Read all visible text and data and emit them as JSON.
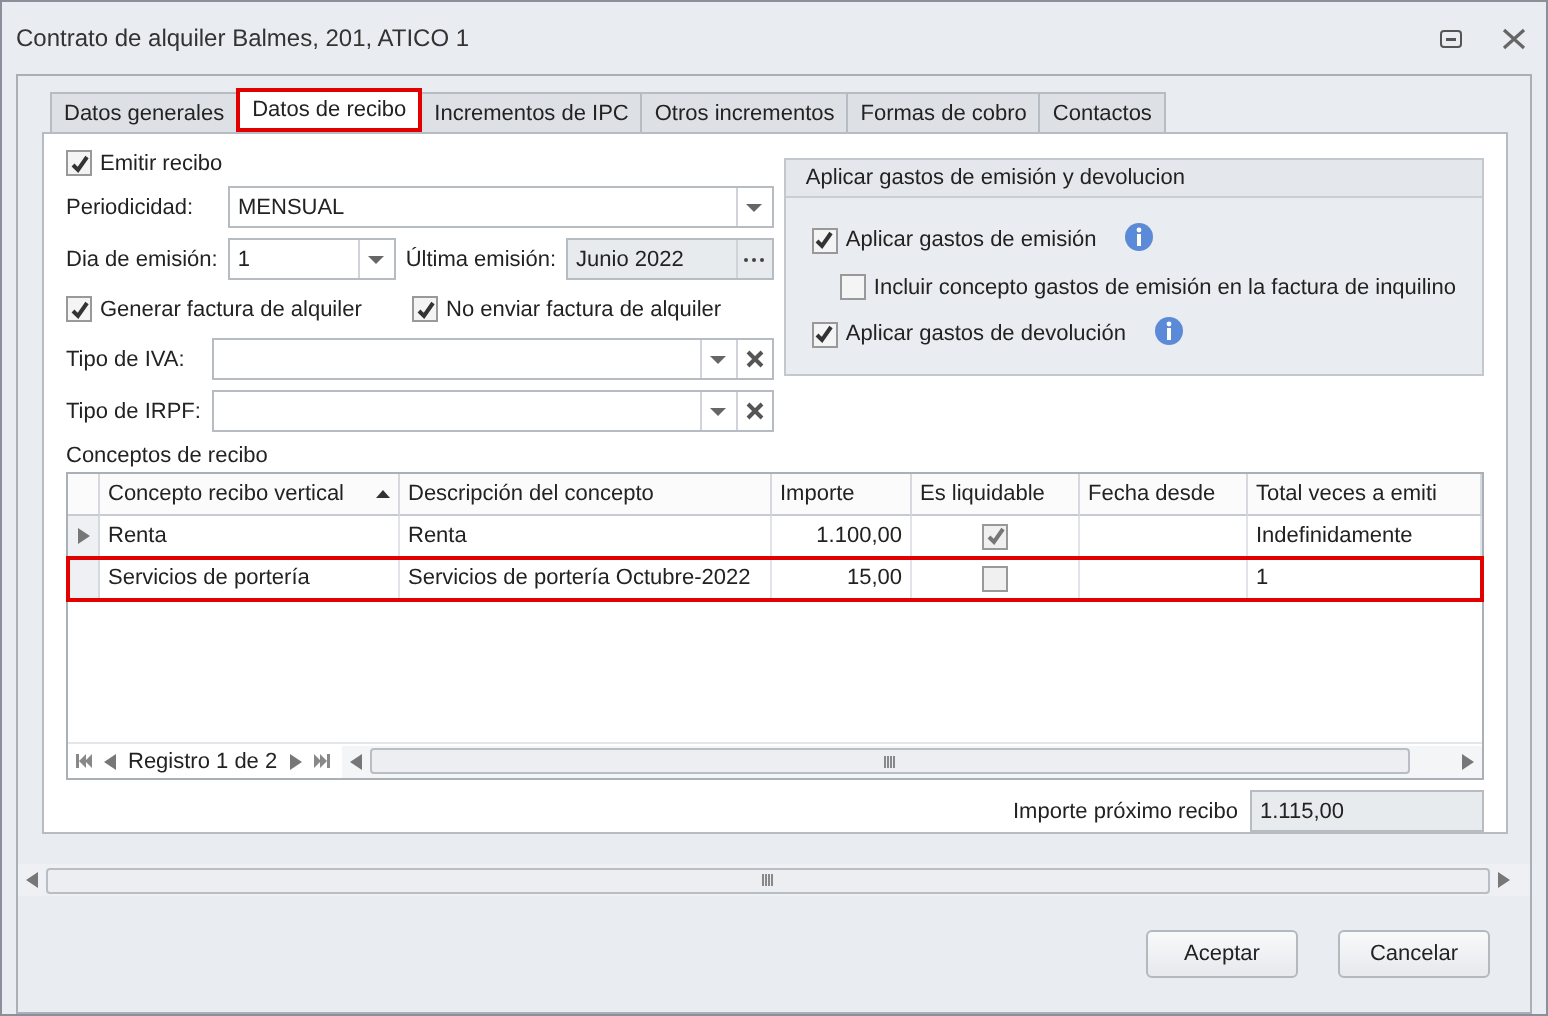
{
  "window": {
    "title": "Contrato de alquiler Balmes, 201, ATICO 1"
  },
  "tabs": [
    {
      "label": "Datos generales",
      "selected": false
    },
    {
      "label": "Datos de recibo",
      "selected": true
    },
    {
      "label": "Incrementos de IPC",
      "selected": false
    },
    {
      "label": "Otros incrementos",
      "selected": false
    },
    {
      "label": "Formas de cobro",
      "selected": false
    },
    {
      "label": "Contactos",
      "selected": false
    }
  ],
  "emit_receipt": {
    "label": "Emitir recibo",
    "checked": true
  },
  "periodicity": {
    "label": "Periodicidad:",
    "value": "MENSUAL"
  },
  "issue_day": {
    "label": "Dia de emisión:",
    "value": "1"
  },
  "last_issue": {
    "label": "Última emisión:",
    "value": "Junio 2022"
  },
  "invoice_options": [
    {
      "label": "Generar factura de alquiler",
      "checked": true
    },
    {
      "label": "No enviar factura de alquiler",
      "checked": true
    }
  ],
  "vat_type": {
    "label": "Tipo de IVA:"
  },
  "irpf_type": {
    "label": "Tipo de IRPF:"
  },
  "fees_group": {
    "title": "Aplicar gastos de emisión y devolucion",
    "options": [
      {
        "label": "Aplicar gastos de emisión",
        "checked": true,
        "info": true,
        "children": [
          {
            "label": "Incluir concepto gastos de emisión en la factura de inquilino",
            "checked": false
          }
        ]
      },
      {
        "label": "Aplicar gastos de devolución",
        "checked": true,
        "info": true
      }
    ]
  },
  "concepts": {
    "title": "Conceptos de recibo",
    "columns": [
      {
        "label": "Concepto recibo vertical",
        "sorted": true
      },
      {
        "label": "Descripción del concepto",
        "sorted": false
      },
      {
        "label": "Importe",
        "sorted": false
      },
      {
        "label": "Es liquidable",
        "sorted": false
      },
      {
        "label": "Fecha desde",
        "sorted": false
      },
      {
        "label": "Total veces a emiti",
        "sorted": false
      }
    ],
    "rows": [
      {
        "concept": "Renta",
        "description": "Renta",
        "amount": "1.100,00",
        "liquidable": true,
        "total": "Indefinidamente",
        "current": true,
        "highlighted": false
      },
      {
        "concept": "Servicios de portería",
        "description": "Servicios de portería Octubre-2022",
        "amount": "15,00",
        "liquidable": false,
        "total": "1",
        "current": false,
        "highlighted": true
      }
    ],
    "navigator": "Registro 1 de 2"
  },
  "next_amount": {
    "label": "Importe próximo recibo",
    "value": "1.115,00"
  },
  "buttons": [
    "Aceptar",
    "Cancelar"
  ]
}
